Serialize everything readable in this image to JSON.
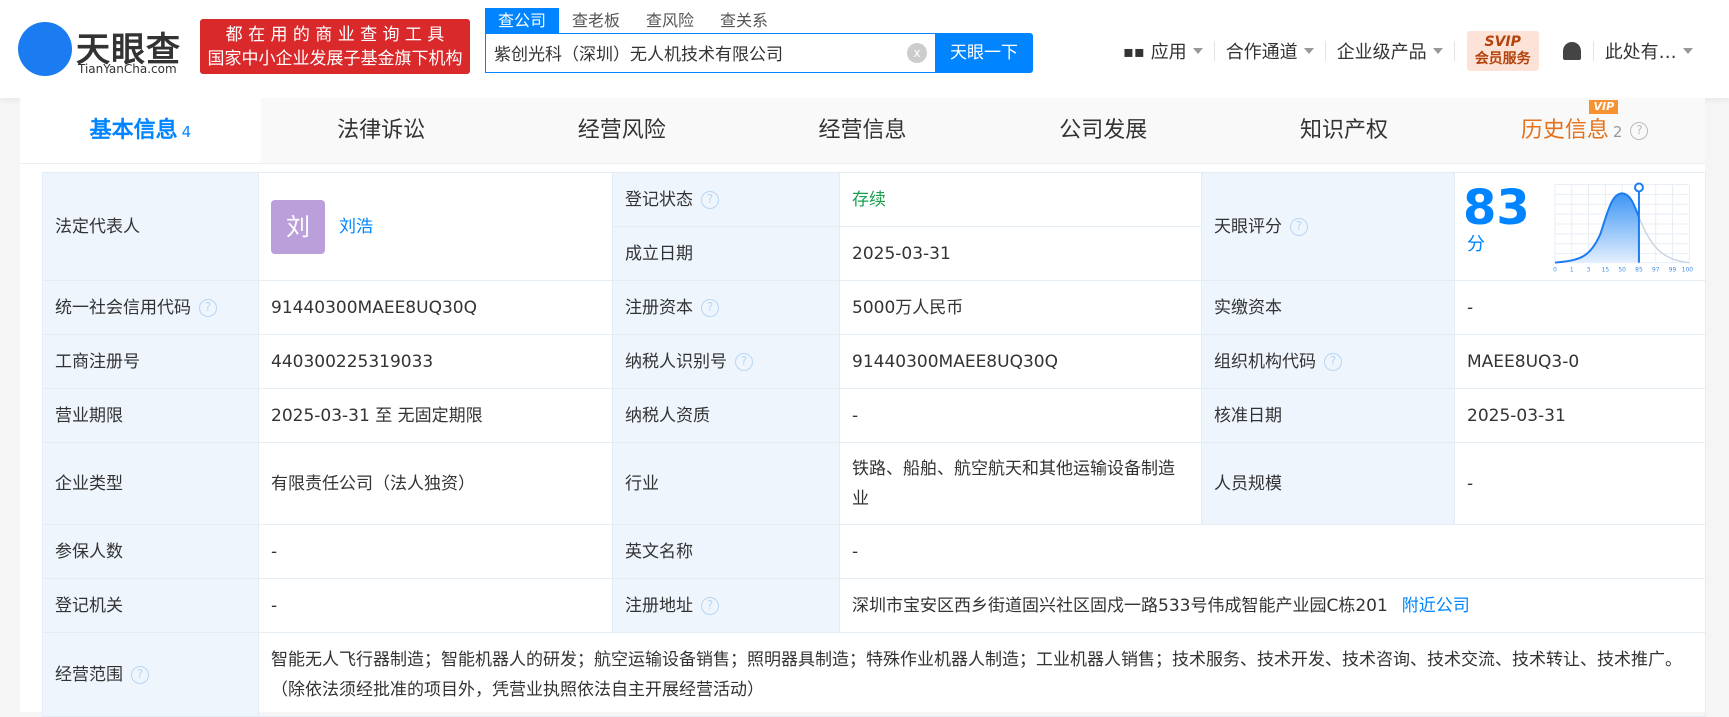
{
  "header": {
    "logo_text": "天眼查",
    "logo_sub": "TianYanCha.com",
    "slogan1": "都 在 用 的 商 业 查 询 工 具",
    "slogan2": "国家中小企业发展子基金旗下机构",
    "search_tabs": [
      "查公司",
      "查老板",
      "查风险",
      "查关系"
    ],
    "search_value": "紫创光科（深圳）无人机技术有限公司",
    "search_button": "天眼一下",
    "nav": [
      "应用",
      "合作通道",
      "企业级产品"
    ],
    "svip_top": "SVIP",
    "svip_bottom": "会员服务",
    "user": "此处有…"
  },
  "tabs": [
    {
      "label": "基本信息",
      "count": "4"
    },
    {
      "label": "法律诉讼"
    },
    {
      "label": "经营风险"
    },
    {
      "label": "经营信息"
    },
    {
      "label": "公司发展"
    },
    {
      "label": "知识产权"
    },
    {
      "label": "历史信息",
      "count": "2",
      "badge": "VIP"
    }
  ],
  "info": {
    "legal_rep_label": "法定代表人",
    "legal_rep_avatar": "刘",
    "legal_rep": "刘浩",
    "status_label": "登记状态",
    "status": "存续",
    "founded_label": "成立日期",
    "founded": "2025-03-31",
    "score_label": "天眼评分",
    "score": "83",
    "score_unit": "分",
    "score_ticks": [
      "0",
      "1",
      "3",
      "15",
      "50",
      "85",
      "97",
      "99",
      "100"
    ],
    "credit_label": "统一社会信用代码",
    "credit": "91440300MAEE8UQ30Q",
    "capital_label": "注册资本",
    "capital": "5000万人民币",
    "paid_label": "实缴资本",
    "paid": "-",
    "reg_no_label": "工商注册号",
    "reg_no": "440300225319033",
    "tax_label": "纳税人识别号",
    "tax": "91440300MAEE8UQ30Q",
    "org_label": "组织机构代码",
    "org": "MAEE8UQ3-0",
    "term_label": "营业期限",
    "term": "2025-03-31 至 无固定期限",
    "taxq_label": "纳税人资质",
    "taxq": "-",
    "approve_label": "核准日期",
    "approve": "2025-03-31",
    "type_label": "企业类型",
    "type": "有限责任公司（法人独资）",
    "industry_label": "行业",
    "industry": "铁路、船舶、航空航天和其他运输设备制造业",
    "staff_label": "人员规模",
    "staff": "-",
    "insured_label": "参保人数",
    "insured": "-",
    "en_label": "英文名称",
    "en": "-",
    "authority_label": "登记机关",
    "authority": "-",
    "addr_label": "注册地址",
    "addr": "深圳市宝安区西乡街道固兴社区固戍一路533号伟成智能产业园C栋201",
    "nearby": "附近公司",
    "scope_label": "经营范围",
    "scope": "智能无人飞行器制造；智能机器人的研发；航空运输设备销售；照明器具制造；特殊作业机器人制造；工业机器人销售；技术服务、技术开发、技术咨询、技术交流、技术转让、技术推广。（除依法须经批准的项目外，凭营业执照依法自主开展经营活动）"
  }
}
